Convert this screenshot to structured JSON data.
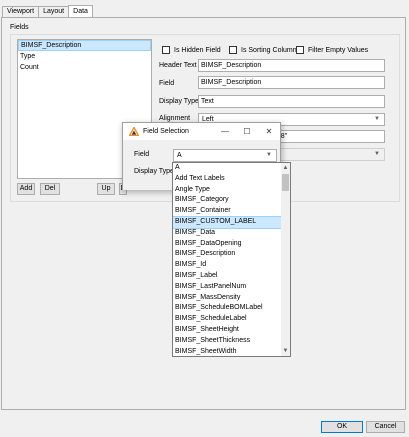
{
  "tabs": [
    {
      "label": "Viewport"
    },
    {
      "label": "Layout"
    },
    {
      "label": "Data"
    }
  ],
  "fields_group": {
    "label": "Fields",
    "items": [
      "BIMSF_Description",
      "Type",
      "Count"
    ]
  },
  "list_buttons": {
    "add": "Add",
    "del": "Del",
    "up": "Up",
    "down_partial": "D"
  },
  "options": {
    "is_hidden_field": "Is Hidden Field",
    "is_sorting_column": "Is Sorting Column",
    "filter_empty_values": "Filter Empty Values"
  },
  "props": {
    "header_text_label": "Header Text",
    "header_text_value": "BIMSF_Description",
    "field_label": "Field",
    "field_value": "BIMSF_Description",
    "display_type_label": "Display Type",
    "display_type_value": "Text",
    "alignment_label": "Alignment",
    "alignment_value": "Left",
    "partial_value": "128\""
  },
  "bottom": {
    "ok": "OK",
    "cancel": "Cancel"
  },
  "dialog": {
    "title": "Field Selection",
    "minimize": "—",
    "maximize": "☐",
    "close": "✕",
    "field_label": "Field",
    "field_value": "A",
    "display_type_label": "Display Type"
  },
  "dropdown_options": [
    "A",
    "Add Text Labels",
    "Angle Type",
    "BIMSF_Category",
    "BIMSF_Container",
    "BIMSF_CUSTOM_LABEL",
    "BIMSF_Data",
    "BIMSF_DataOpening",
    "BIMSF_Description",
    "BIMSF_Id",
    "BIMSF_Label",
    "BIMSF_LastPanelNum",
    "BIMSF_MassDensity",
    "BIMSF_ScheduleBOMLabel",
    "BIMSF_ScheduleLabel",
    "BIMSF_SheetHeight",
    "BIMSF_SheetThickness",
    "BIMSF_SheetWidth"
  ],
  "selected_option": "BIMSF_CUSTOM_LABEL",
  "colors": {
    "selection": "#cce8ff",
    "accent": "#0078d7",
    "app_icon": "#e8912d"
  }
}
